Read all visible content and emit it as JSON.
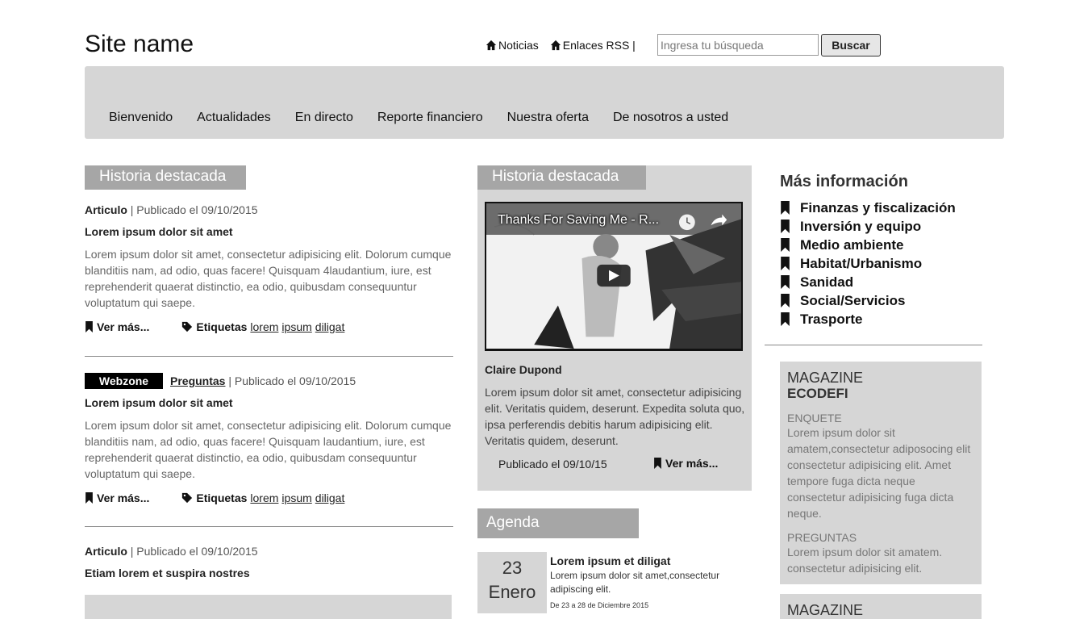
{
  "header": {
    "site_name": "Site name",
    "links": [
      {
        "label": "Noticias",
        "icon": "home-icon"
      },
      {
        "label": "Enlaces RSS |",
        "icon": "home-icon"
      }
    ],
    "search_placeholder": "Ingresa tu búsqueda",
    "search_button": "Buscar"
  },
  "nav": {
    "items": [
      "Bienvenido",
      "Actualidades",
      "En directo",
      "Reporte financiero",
      "Nuestra oferta",
      "De nosotros a usted"
    ]
  },
  "left": {
    "section_title": "Historia destacada",
    "articles": [
      {
        "type": "Articulo",
        "published": "| Publicado el 09/10/2015",
        "title": "Lorem ipsum dolor sit amet",
        "body": "Lorem ipsum dolor sit amet, consectetur adipisicing elit. Dolorum cumque blanditiis nam, ad odio, quas facere! Quisquam 4laudantium, iure, est reprehenderit quaerat distinctio, ea odio, quibusdam consequuntur voluptatum qui saepe.",
        "read_more": "Ver más...",
        "tags_label": "Etiquetas",
        "tags": [
          "lorem",
          "ipsum",
          "diligat"
        ]
      },
      {
        "badge": "Webzone",
        "type": "Preguntas",
        "published": "| Publicado el 09/10/2015",
        "title": "Lorem ipsum dolor sit amet",
        "body": "Lorem ipsum dolor sit amet, consectetur adipisicing elit. Dolorum cumque blanditiis nam, ad odio, quas facere! Quisquam laudantium, iure, est reprehenderit quaerat distinctio, ea odio, quibusdam consequuntur voluptatum qui saepe.",
        "read_more": "Ver más...",
        "tags_label": "Etiquetas",
        "tags": [
          "lorem",
          "ipsum",
          "diligat"
        ]
      },
      {
        "type": "Articulo",
        "published": "| Publicado el 09/10/2015",
        "title": "Etiam lorem et suspira nostres"
      }
    ]
  },
  "middle": {
    "section_title": "Historia destacada",
    "video_title": "Thanks For Saving Me - R...",
    "author": "Claire Dupond",
    "body": "Lorem ipsum dolor sit amet, consectetur adipisicing elit. Veritatis quidem, deserunt. Expedita soluta quo, ipsa perferendis debitis harum adipisicing elit. Veritatis quidem, deserunt.",
    "published": "Publicado el 09/10/15",
    "read_more": "Ver más...",
    "agenda": {
      "title": "Agenda",
      "day": "23",
      "month": "Enero",
      "event_title": "Lorem ipsum et diligat",
      "event_body": "Lorem ipsum dolor sit amet,consectetur adipiscing elit.",
      "event_range": "De 23 a 28 de Diciembre 2015"
    }
  },
  "right": {
    "title": "Más información",
    "categories": [
      "Finanzas y fiscalización",
      "Inversión y equipo",
      "Medio ambiente",
      "Habitat/Urbanismo",
      "Sanidad",
      "Social/Servicios",
      "Trasporte"
    ],
    "magazine1": {
      "head": "MAGAZINE",
      "brand": "ECODEFI",
      "sub1": "ENQUETE",
      "txt1": "Lorem ipsum dolor sit amatem,consectetur adiposocing elit consectetur adipisicing elit. Amet tempore fuga dicta neque consectetur adipisicing fuga dicta neque.",
      "sub2": "PREGUNTAS",
      "txt2": "Lorem ipsum dolor sit amatem. consectetur adipisicing elit."
    },
    "magazine2": {
      "head": "MAGAZINE"
    }
  }
}
